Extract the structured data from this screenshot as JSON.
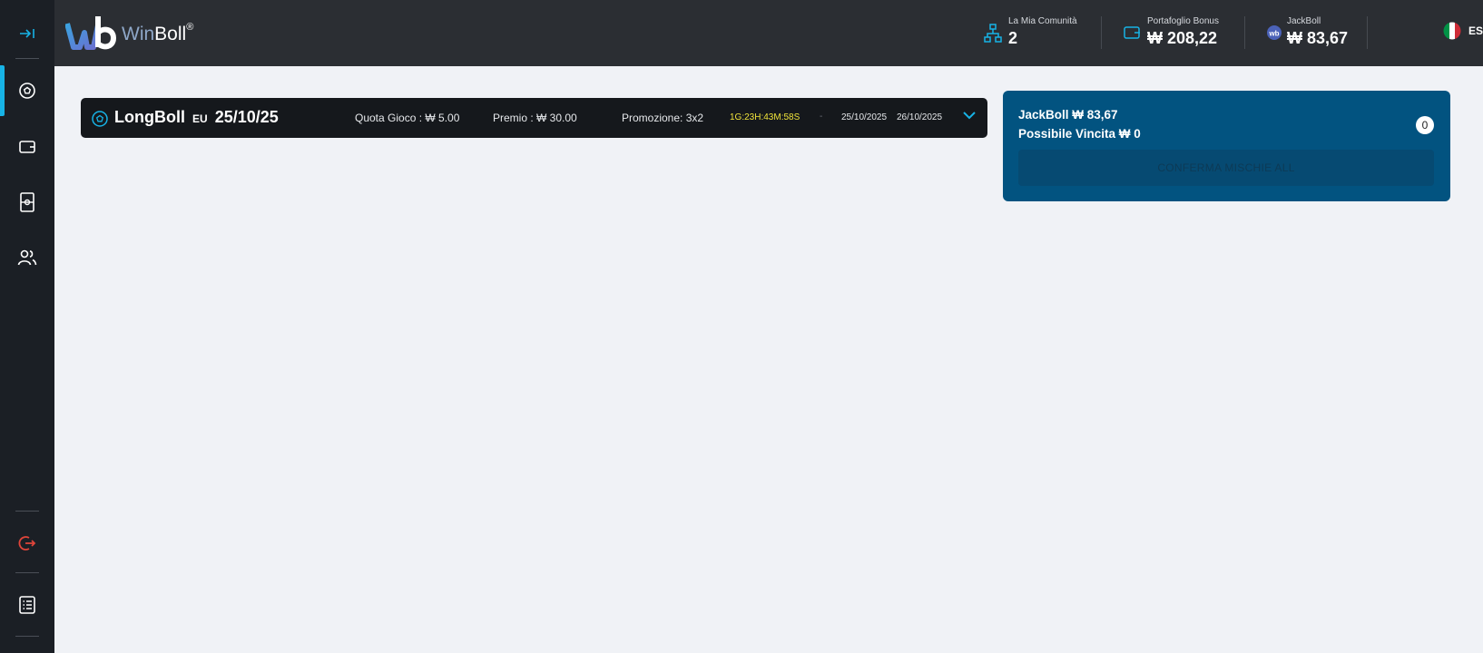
{
  "brand": {
    "name_part1": "Win",
    "name_part2": "Boll",
    "registered": "®"
  },
  "topbar": {
    "community": {
      "label": "La Mia Comunità",
      "value": "2"
    },
    "bonus": {
      "label": "Portafoglio Bonus",
      "value": "₩ 208,22"
    },
    "jackboll": {
      "label": "JackBoll",
      "value": "₩ 83,67"
    },
    "language": {
      "label": "ESSO"
    }
  },
  "game": {
    "title": "LongBoll",
    "region": "EU",
    "date": "25/10/25",
    "quota": "Quota Gioco : ₩ 5.00",
    "premio": "Premio : ₩ 30.00",
    "promozione": "Promozione: 3x2",
    "timer": "1G:23H:43M:58S",
    "separator": "-",
    "start_date": "25/10/2025",
    "end_date": "26/10/2025"
  },
  "jackpot_card": {
    "jackboll": "JackBoll ₩ 83,67",
    "possible_win": "Possibile Vincita ₩ 0",
    "count": "0",
    "confirm_label": "CONFERMA MISCHIE ALL"
  },
  "colors": {
    "accent": "#17b3e6",
    "sidebar_bg": "#1b1f25",
    "topbar_bg": "#2b2e33",
    "card_bg": "#025380",
    "timer": "#f1e43a",
    "logout": "#e0453a"
  },
  "icons": {
    "sidebar": [
      "expand-icon",
      "soccer-ball-icon",
      "wallet-icon",
      "ticket-icon",
      "users-icon",
      "logout-icon",
      "list-icon"
    ]
  }
}
